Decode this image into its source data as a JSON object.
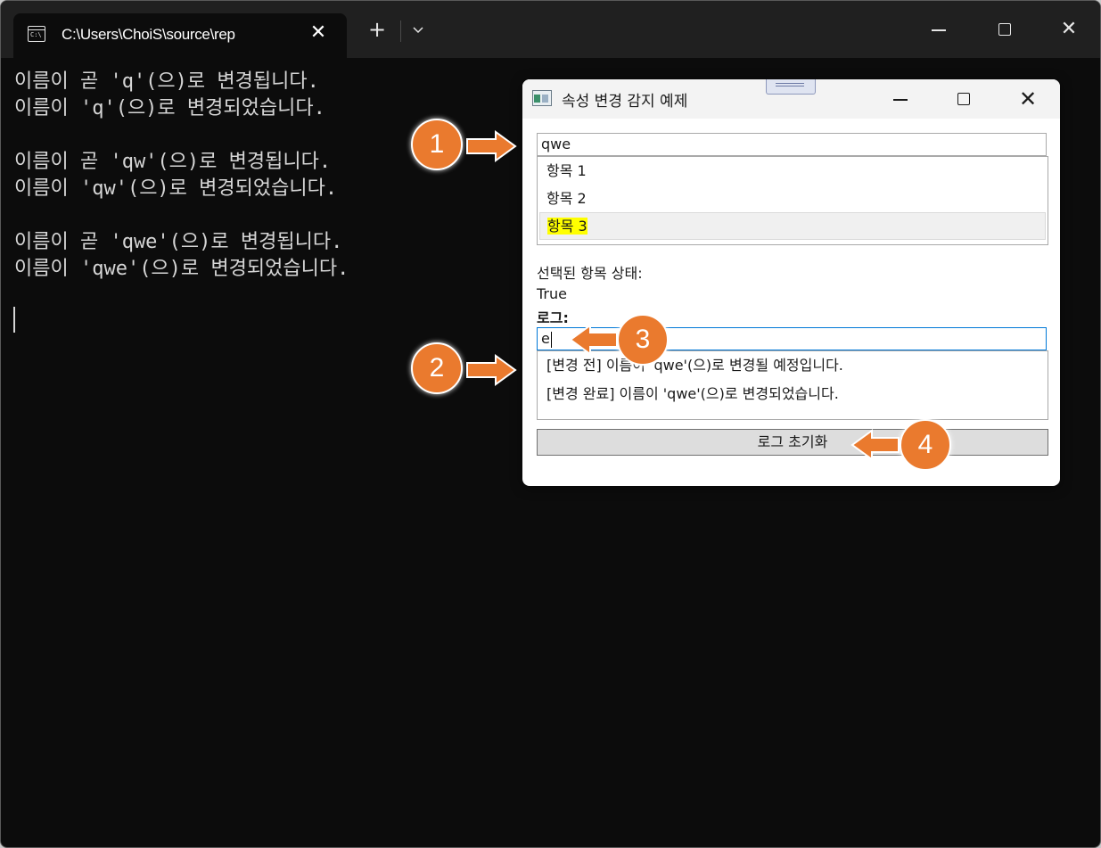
{
  "terminal": {
    "tab_title": "C:\\Users\\ChoiS\\source\\rep",
    "tab_icon_label": "C:\\",
    "new_tab_label": "+",
    "dropdown_label": "⌄",
    "close_tab_label": "✕",
    "window_close_label": "✕",
    "console_lines": [
      "이름이 곧 'q'(으)로 변경됩니다.",
      "이름이 'q'(으)로 변경되었습니다.",
      "",
      "이름이 곧 'qw'(으)로 변경됩니다.",
      "이름이 'qw'(으)로 변경되었습니다.",
      "",
      "이름이 곧 'qwe'(으)로 변경됩니다.",
      "이름이 'qwe'(으)로 변경되었습니다."
    ]
  },
  "dialog": {
    "title": "속성 변경 감지 예제",
    "close_label": "✕",
    "name_input_value": "qwe",
    "items": [
      "항목 1",
      "항목 2",
      "항목 3"
    ],
    "selected_index": 2,
    "selected_label": "선택된 항목 상태:",
    "selected_value": "True",
    "log_label": "로그:",
    "log_input_value": "e",
    "log_entries": [
      "[변경 전] 이름이 'qwe'(으)로 변경될 예정입니다.",
      "[변경 완료] 이름이 'qwe'(으)로 변경되었습니다."
    ],
    "reset_button_label": "로그 초기화"
  },
  "callouts": [
    "1",
    "2",
    "3",
    "4"
  ],
  "colors": {
    "callout_fill": "#ea7a2e",
    "highlight": "#ffff00",
    "terminal_bg": "#0c0c0c"
  }
}
